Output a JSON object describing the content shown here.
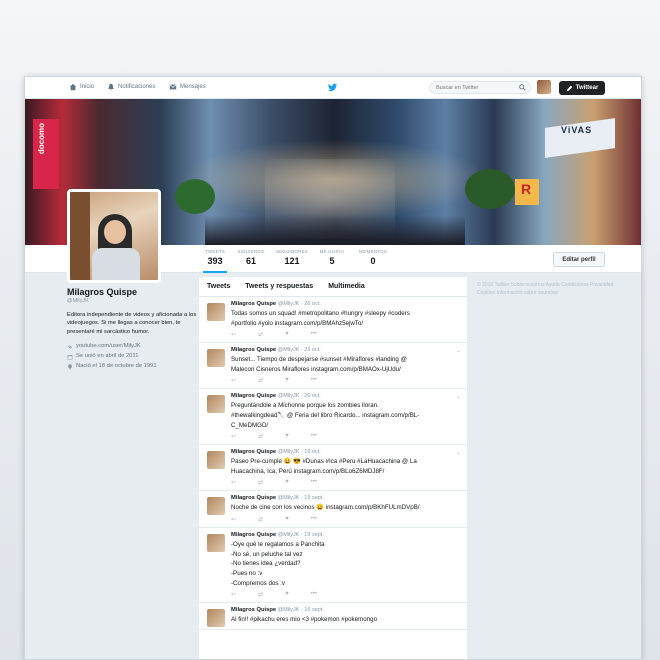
{
  "nav": {
    "home": "Inicio",
    "notifications": "Notificaciones",
    "messages": "Mensajes",
    "search_placeholder": "Buscar en Twitter",
    "tweet_button": "Twittear"
  },
  "banner": {
    "sign_left": "docomo",
    "sign_right": "ViVAS",
    "sign_r": "R"
  },
  "stats": [
    {
      "label": "TWEETS",
      "value": "393"
    },
    {
      "label": "SIGUIENDO",
      "value": "61"
    },
    {
      "label": "SEGUIDORES",
      "value": "121"
    },
    {
      "label": "ME GUSTA",
      "value": "5"
    },
    {
      "label": "MOMENTOS",
      "value": "0"
    }
  ],
  "edit_profile": "Editar perfil",
  "profile": {
    "name": "Milagros Quispe",
    "handle": "@MilyJK",
    "bio": "Editora independiente de videos y aficionada a los videojuegos. Si me llegas a conocer bien, te presentaré mi sarcástico humor.",
    "website": "youtube.com/user/MilyJK",
    "joined": "Se unió en abril de 2011",
    "born": "Nació el 18 de octubre de 1991"
  },
  "tabs": [
    "Tweets",
    "Tweets y respuestas",
    "Multimedia"
  ],
  "tweets": [
    {
      "name": "Milagros Quispe",
      "meta": "@MilyJK · 26 oct.",
      "text": "Todas somos un squad! #metropolitano #hungry #sleepy #coders\n#portfolio #yolo instagram.com/p/BMAhz5ejwTo/"
    },
    {
      "name": "Milagros Quispe",
      "meta": "@MilyJK · 26 oct.",
      "text": "Sunset... Tiempo de despejarse #sunset #Miraflores #landing @\nMalecon Cisneros Miraflores instagram.com/p/BMAOx-UjUdu/"
    },
    {
      "name": "Milagros Quispe",
      "meta": "@MilyJK · 26 oct.",
      "text": "Preguntándole a Michonne porque los zombies lloran.\n#thewalkingdead🔪 @ Feria del libro Ricardo... instagram.com/p/BL-\nC_MeDMGD/"
    },
    {
      "name": "Milagros Quispe",
      "meta": "@MilyJK · 16 oct.",
      "text": "Paseo Pre-cumple 😀 😎 #Dunas #Ica #Peru #LaHuacachina @ La\nHuacachina, Ica, Perú instagram.com/p/BLo6Z6MDJ8F/"
    },
    {
      "name": "Milagros Quispe",
      "meta": "@MilyJK · 19 sept.",
      "text": "Noche de cine con los vecinos 😀 instagram.com/p/BKhFULmDVpB/"
    },
    {
      "name": "Milagros Quispe",
      "meta": "@MilyJK · 19 sept.",
      "text": "-Oye qué le regalamos a Panchita\n-No sé, un peluche tal vez\n-No tienes idea ¿verdad?\n-Pues no :v\n-Compremos dos :v"
    },
    {
      "name": "Milagros Quispe",
      "meta": "@MilyJK · 16 sept.",
      "text": "Al fin!! #pikachu eres mio <3 #pokemon #pokemongo"
    }
  ],
  "footer": "© 2016 Twitter  Sobre nosotros  Ayuda  Condiciones  Privacidad  Cookies  Información sobre anuncios",
  "colors": {
    "accent": "#1da1f2",
    "tweet_button_bg": "#1f2225",
    "page_bg": "#e6ecf0"
  }
}
